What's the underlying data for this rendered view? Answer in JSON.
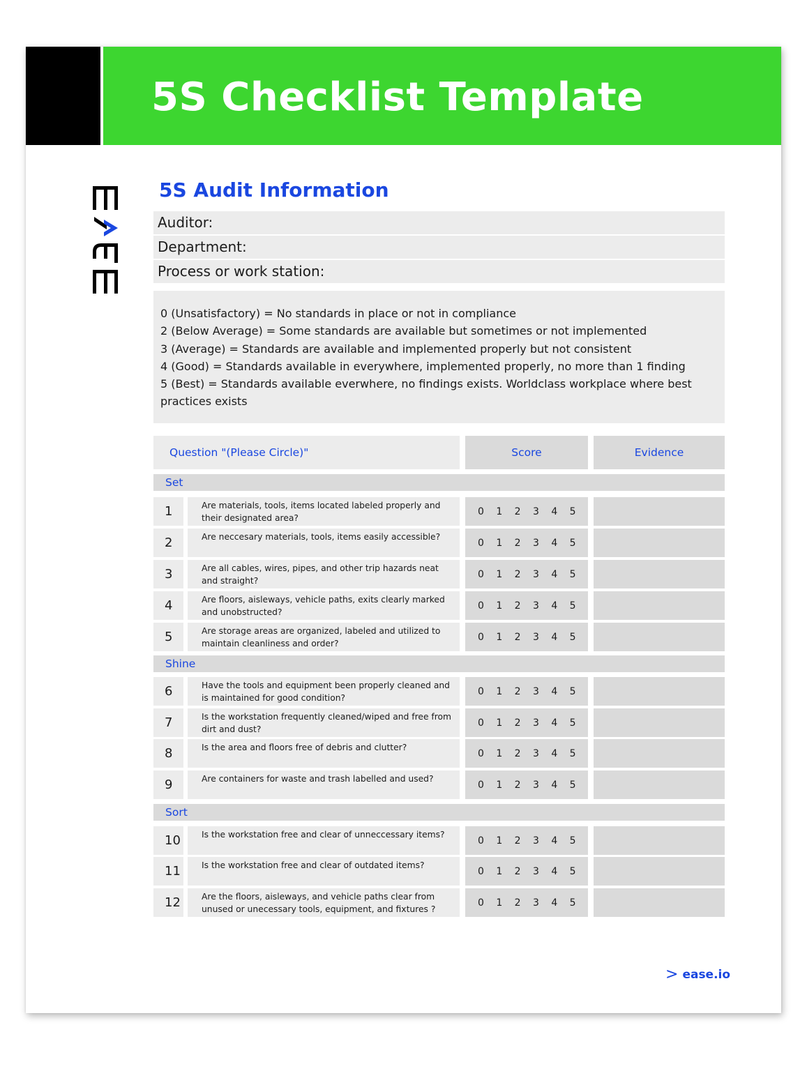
{
  "header": {
    "title": "5S Checklist Template",
    "brand_color": "#3dd630",
    "accent_color": "#1a47e0"
  },
  "logo": {
    "text": "EASE",
    "orientation": "rotated-90"
  },
  "audit_info": {
    "title": "5S Audit Information",
    "fields": [
      {
        "label": "Auditor:",
        "value": ""
      },
      {
        "label": "Department:",
        "value": ""
      },
      {
        "label": "Process or work station:",
        "value": ""
      }
    ]
  },
  "scoring_legend": [
    "0 (Unsatisfactory) = No standards in place or not in compliance",
    "2 (Below Average) = Some standards are available but sometimes or not implemented",
    "3 (Average) = Standards are available and implemented properly but not consistent",
    "4 (Good) = Standards available in everywhere, implemented properly, no more than 1 finding",
    "5 (Best) = Standards available everwhere, no findings exists.  Worldclass workplace where best",
    "practices exists"
  ],
  "table": {
    "headers": {
      "question": "Question \"(Please Circle)\"",
      "score": "Score",
      "evidence": "Evidence"
    },
    "score_options": [
      "0",
      "1",
      "2",
      "3",
      "4",
      "5"
    ],
    "sections": [
      {
        "name": "Set",
        "rows": [
          {
            "num": "1",
            "question": "Are materials, tools, items located labeled properly and their designated area?",
            "evidence": ""
          },
          {
            "num": "2",
            "question": "Are neccesary materials, tools, items easily accessible?",
            "evidence": ""
          },
          {
            "num": "3",
            "question": "Are all cables, wires, pipes, and other trip hazards neat and straight?",
            "evidence": ""
          },
          {
            "num": "4",
            "question": "Are floors, aisleways, vehicle paths, exits clearly marked and unobstructed?",
            "evidence": ""
          },
          {
            "num": "5",
            "question": "Are storage areas are organized, labeled and utilized to maintain cleanliness and order?",
            "evidence": ""
          }
        ]
      },
      {
        "name": "Shine",
        "rows": [
          {
            "num": "6",
            "question": "Have the tools and equipment been properly cleaned and is maintained for good condition?",
            "evidence": ""
          },
          {
            "num": "7",
            "question": "Is the workstation frequently cleaned/wiped and free from dirt and dust?",
            "evidence": ""
          },
          {
            "num": "8",
            "question": "Is the area and floors free of debris and clutter?",
            "evidence": ""
          },
          {
            "num": "9",
            "question": "Are containers for waste and trash labelled and used?",
            "evidence": ""
          }
        ]
      },
      {
        "name": "Sort",
        "rows": [
          {
            "num": "10",
            "question": "Is the workstation free and clear of unneccessary items?",
            "evidence": ""
          },
          {
            "num": "11",
            "question": "Is the workstation free and clear of outdated items?",
            "evidence": ""
          },
          {
            "num": "12",
            "question": "Are the floors, aisleways, and vehicle paths clear from unused or unecessary tools, equipment, and fixtures ?",
            "evidence": ""
          }
        ]
      }
    ]
  },
  "footer": {
    "link_icon": "chevron-right-icon",
    "link_text": "ease.io"
  }
}
